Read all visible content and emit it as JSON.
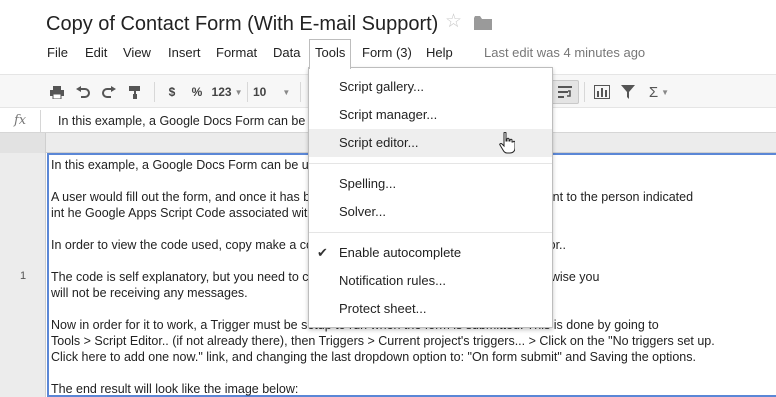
{
  "document": {
    "title": "Copy of Contact Form (With E-mail Support)"
  },
  "icons": {
    "star": "star-icon",
    "folder": "folder-icon",
    "function": "fx-icon"
  },
  "menubar": {
    "items": [
      "File",
      "Edit",
      "View",
      "Insert",
      "Format",
      "Data",
      "Tools",
      "Form (3)",
      "Help"
    ],
    "open_item": "Tools",
    "last_edit": "Last edit was 4 minutes ago"
  },
  "toolbar": {
    "currency": "$",
    "percent": "%",
    "number_format": "123",
    "font_size": "10"
  },
  "formula_bar": {
    "fx_label": "fx",
    "value": "In this example, a Google Docs Form can be used as a Contact Form."
  },
  "grid": {
    "row_number": "1",
    "cell_paragraphs": [
      "In this example, a Google Docs Form can be used as a Contact Form.",
      "A user would fill out the form, and once it has been submitted, an e-mail is automatically sent to the person indicated\nint he Google Apps Script Code associated with it.",
      "In order to view the code used, copy make a copy of the form and go to Tools > Script Editor..",
      "The code is self explanatory, but you need to change \"email@ljv.com\" to your e-mail other wise you\nwill not be receiving any messages.",
      "Now in order for it to work, a Trigger must be setup to run when the form is submitted. This is done by going to\nTools > Script Editor.. (if not already there), then Triggers > Current project's triggers... > Click on the \"No triggers set up.\nClick here to add one now.\" link, and changing the last dropdown option to: \"On form submit\" and Saving the options.",
      "The end result will look like the image below:"
    ]
  },
  "tools_menu": {
    "items": [
      {
        "label": "Script gallery...",
        "checked": false,
        "hover": false
      },
      {
        "label": "Script manager...",
        "checked": false,
        "hover": false
      },
      {
        "label": "Script editor...",
        "checked": false,
        "hover": true
      },
      {
        "separator": true
      },
      {
        "label": "Spelling...",
        "checked": false,
        "hover": false
      },
      {
        "label": "Solver...",
        "checked": false,
        "hover": false
      },
      {
        "separator": true
      },
      {
        "label": "Enable autocomplete",
        "checked": true,
        "hover": false
      },
      {
        "label": "Notification rules...",
        "checked": false,
        "hover": false
      },
      {
        "label": "Protect sheet...",
        "checked": false,
        "hover": false
      }
    ]
  }
}
